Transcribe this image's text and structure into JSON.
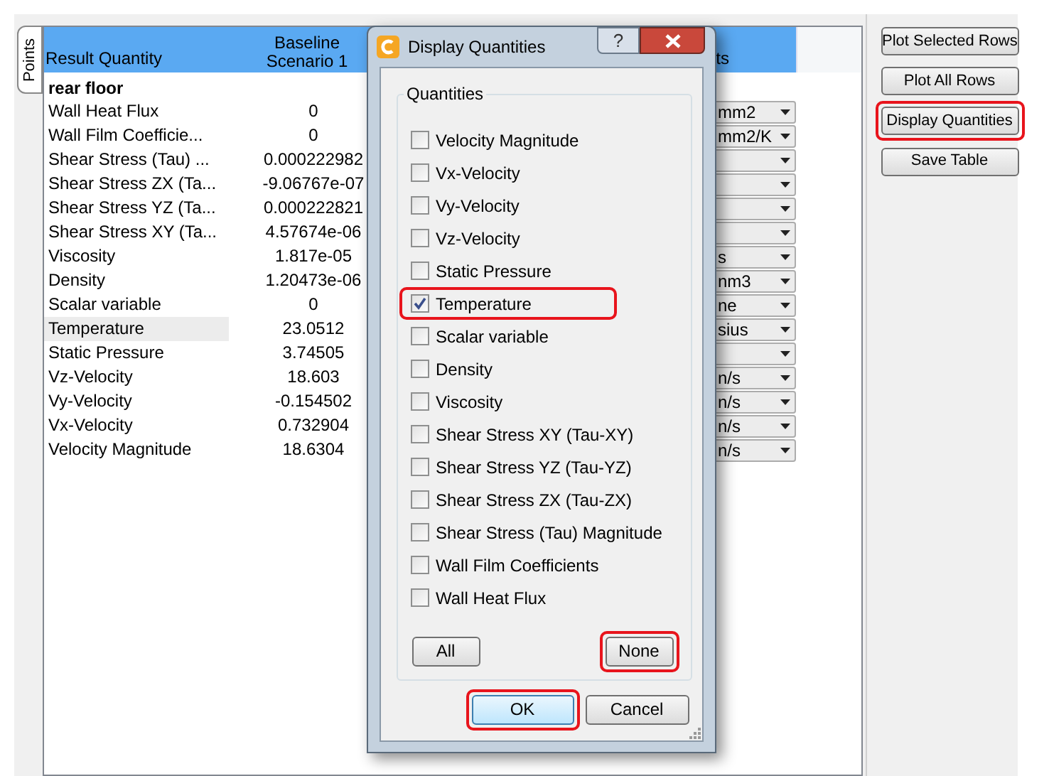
{
  "side_tab": {
    "label": "Points",
    "selected": true
  },
  "table": {
    "columns": [
      "Result Quantity",
      "Baseline Scenario 1",
      "ts"
    ],
    "group": "rear floor",
    "rows": [
      {
        "name": "Wall Heat Flux",
        "value": "0",
        "unit": "mm2",
        "selected": false
      },
      {
        "name": "Wall Film Coefficie...",
        "value": "0",
        "unit": "mm2/K",
        "selected": false
      },
      {
        "name": "Shear Stress (Tau) ...",
        "value": "0.000222982",
        "selected": false
      },
      {
        "name": "Shear Stress ZX (Ta...",
        "value": "-9.06767e-07",
        "selected": false
      },
      {
        "name": "Shear Stress YZ (Ta...",
        "value": "0.000222821",
        "selected": false
      },
      {
        "name": "Shear Stress XY (Ta...",
        "value": "4.57674e-06",
        "selected": false
      },
      {
        "name": "Viscosity",
        "value": "1.817e-05",
        "unit": "s",
        "selected": false
      },
      {
        "name": "Density",
        "value": "1.20473e-06",
        "unit": "nm3",
        "selected": false
      },
      {
        "name": "Scalar variable",
        "value": "0",
        "unit": "ne",
        "selected": false
      },
      {
        "name": "Temperature",
        "value": "23.0512",
        "unit": "sius",
        "selected": true
      },
      {
        "name": "Static Pressure",
        "value": "3.74505",
        "selected": false
      },
      {
        "name": "Vz-Velocity",
        "value": "18.603",
        "unit": "n/s",
        "selected": false
      },
      {
        "name": "Vy-Velocity",
        "value": "-0.154502",
        "unit": "n/s",
        "selected": false
      },
      {
        "name": "Vx-Velocity",
        "value": "0.732904",
        "unit": "n/s",
        "selected": false
      },
      {
        "name": "Velocity Magnitude",
        "value": "18.6304",
        "unit": "n/s",
        "selected": false
      }
    ]
  },
  "side_buttons": [
    {
      "label": "Plot Selected Rows",
      "highlighted": false
    },
    {
      "label": "Plot All Rows",
      "highlighted": false
    },
    {
      "label": "Display Quantities",
      "highlighted": true
    },
    {
      "label": "Save Table",
      "highlighted": false
    }
  ],
  "dialog": {
    "title": "Display Quantities",
    "help": "?",
    "group_title": "Quantities",
    "items": [
      {
        "label": "Velocity Magnitude",
        "checked": false,
        "highlighted": false
      },
      {
        "label": "Vx-Velocity",
        "checked": false,
        "highlighted": false
      },
      {
        "label": "Vy-Velocity",
        "checked": false,
        "highlighted": false
      },
      {
        "label": "Vz-Velocity",
        "checked": false,
        "highlighted": false
      },
      {
        "label": "Static Pressure",
        "checked": false,
        "highlighted": false
      },
      {
        "label": "Temperature",
        "checked": true,
        "highlighted": true
      },
      {
        "label": "Scalar variable",
        "checked": false,
        "highlighted": false
      },
      {
        "label": "Density",
        "checked": false,
        "highlighted": false
      },
      {
        "label": "Viscosity",
        "checked": false,
        "highlighted": false
      },
      {
        "label": "Shear Stress XY (Tau-XY)",
        "checked": false,
        "highlighted": false
      },
      {
        "label": "Shear Stress YZ (Tau-YZ)",
        "checked": false,
        "highlighted": false
      },
      {
        "label": "Shear Stress ZX (Tau-ZX)",
        "checked": false,
        "highlighted": false
      },
      {
        "label": "Shear Stress (Tau) Magnitude",
        "checked": false,
        "highlighted": false
      },
      {
        "label": "Wall Film Coefficients",
        "checked": false,
        "highlighted": false
      },
      {
        "label": "Wall Heat Flux",
        "checked": false,
        "highlighted": false
      }
    ],
    "group_buttons": [
      {
        "label": "All",
        "highlighted": false
      },
      {
        "label": "None",
        "highlighted": true
      }
    ],
    "buttons": [
      {
        "label": "OK",
        "highlighted": true,
        "default": true
      },
      {
        "label": "Cancel",
        "highlighted": false,
        "default": false
      }
    ]
  }
}
